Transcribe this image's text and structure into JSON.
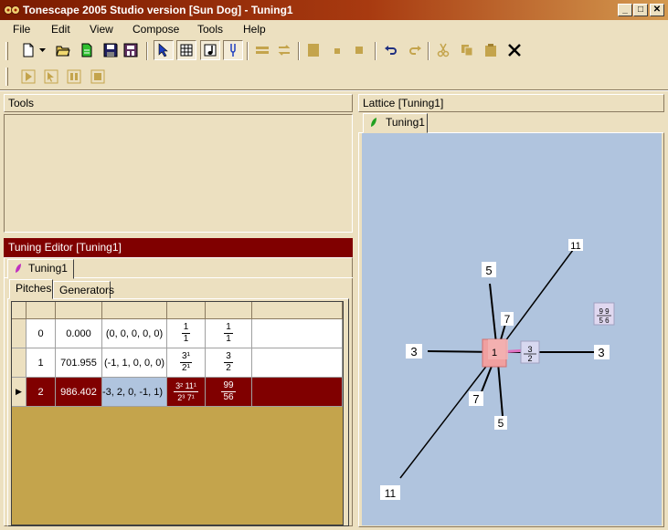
{
  "window": {
    "title": "Tonescape 2005 Studio  version [Sun Dog]  -  Tuning1",
    "minimize": "_",
    "maximize": "□",
    "close": "✕"
  },
  "menu": [
    {
      "label": "File"
    },
    {
      "label": "Edit"
    },
    {
      "label": "View"
    },
    {
      "label": "Compose"
    },
    {
      "label": "Tools"
    },
    {
      "label": "Help"
    }
  ],
  "panels": {
    "tools": {
      "title": "Tools"
    },
    "tuning_editor": {
      "title": "Tuning Editor  [Tuning1]",
      "doc_tab": "Tuning1"
    },
    "lattice": {
      "title": "Lattice  [Tuning1]",
      "doc_tab": "Tuning1"
    }
  },
  "editor_tabs": [
    "Pitches",
    "Generators"
  ],
  "pitches": [
    {
      "index": "0",
      "cents": "0.000",
      "vector": "(0, 0, 0, 0, 0)",
      "factor_num": "1",
      "factor_den": "1",
      "ratio_num": "1",
      "ratio_den": "1"
    },
    {
      "index": "1",
      "cents": "701.955",
      "vector": "(-1, 1, 0, 0, 0)",
      "factor_num": "3¹",
      "factor_den": "2¹",
      "ratio_num": "3",
      "ratio_den": "2"
    },
    {
      "index": "2",
      "cents": "986.402",
      "vector": "-3, 2, 0, -1, 1)",
      "factor_num": "3² 11¹",
      "factor_den": "2³ 7¹",
      "ratio_num": "99",
      "ratio_den": "56"
    }
  ],
  "row_indicator": "▶",
  "lattice": {
    "labels": {
      "eleven_top": "11",
      "five_top": "5",
      "seven_top": "7",
      "three_left": "3",
      "three_right": "3",
      "seven_bottom": "7",
      "five_bottom": "5",
      "eleven_bottom": "11",
      "root": "1",
      "node_3_2_num": "3",
      "node_3_2_den": "2",
      "node_99_56_num": "9 9",
      "node_99_56_den": "5 6"
    }
  },
  "colors": {
    "titlebar_start": "#7a1a00",
    "selection": "#800000",
    "lattice_bg": "#b0c4de",
    "root_node": "#f0a0a0",
    "link": "#e070c0"
  }
}
